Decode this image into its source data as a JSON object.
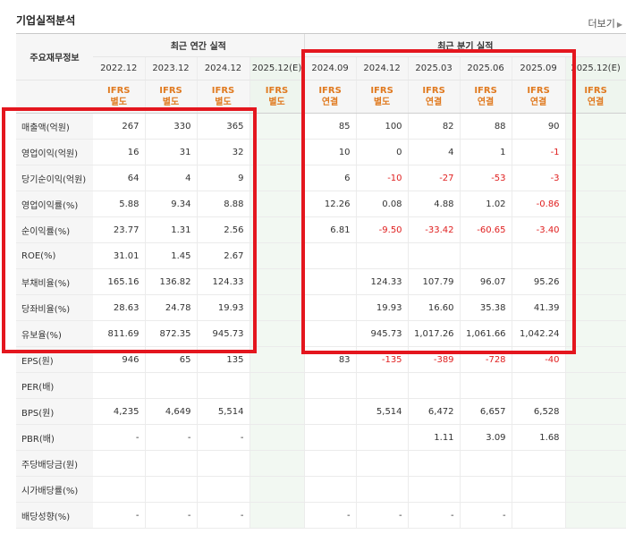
{
  "title": "기업실적분석",
  "more_label": "더보기",
  "header": {
    "row_label": "주요재무정보",
    "annual_group": "최근 연간 실적",
    "quarter_group": "최근 분기 실적",
    "periods": [
      "2022.12",
      "2023.12",
      "2024.12",
      "2025.12(E)",
      "2024.09",
      "2024.12",
      "2025.03",
      "2025.06",
      "2025.09",
      "2025.12(E)"
    ],
    "std_top": [
      "IFRS",
      "IFRS",
      "IFRS",
      "IFRS",
      "IFRS",
      "IFRS",
      "IFRS",
      "IFRS",
      "IFRS",
      "IFRS"
    ],
    "std_bottom": [
      "별도",
      "별도",
      "별도",
      "별도",
      "연결",
      "별도",
      "연결",
      "연결",
      "연결",
      "연결"
    ]
  },
  "rows": [
    {
      "label": "매출액(억원)",
      "values": [
        "267",
        "330",
        "365",
        "",
        "85",
        "100",
        "82",
        "88",
        "90",
        ""
      ]
    },
    {
      "label": "영업이익(억원)",
      "values": [
        "16",
        "31",
        "32",
        "",
        "10",
        "0",
        "4",
        "1",
        "-1",
        ""
      ]
    },
    {
      "label": "당기순이익(억원)",
      "values": [
        "64",
        "4",
        "9",
        "",
        "6",
        "-10",
        "-27",
        "-53",
        "-3",
        ""
      ]
    },
    {
      "label": "영업이익률(%)",
      "values": [
        "5.88",
        "9.34",
        "8.88",
        "",
        "12.26",
        "0.08",
        "4.88",
        "1.02",
        "-0.86",
        ""
      ]
    },
    {
      "label": "순이익률(%)",
      "values": [
        "23.77",
        "1.31",
        "2.56",
        "",
        "6.81",
        "-9.50",
        "-33.42",
        "-60.65",
        "-3.40",
        ""
      ]
    },
    {
      "label": "ROE(%)",
      "values": [
        "31.01",
        "1.45",
        "2.67",
        "",
        "",
        "",
        "",
        "",
        "",
        ""
      ]
    },
    {
      "label": "부채비율(%)",
      "values": [
        "165.16",
        "136.82",
        "124.33",
        "",
        "",
        "124.33",
        "107.79",
        "96.07",
        "95.26",
        ""
      ]
    },
    {
      "label": "당좌비율(%)",
      "values": [
        "28.63",
        "24.78",
        "19.93",
        "",
        "",
        "19.93",
        "16.60",
        "35.38",
        "41.39",
        ""
      ]
    },
    {
      "label": "유보율(%)",
      "values": [
        "811.69",
        "872.35",
        "945.73",
        "",
        "",
        "945.73",
        "1,017.26",
        "1,061.66",
        "1,042.24",
        ""
      ]
    },
    {
      "label": "EPS(원)",
      "values": [
        "946",
        "65",
        "135",
        "",
        "83",
        "-135",
        "-389",
        "-728",
        "-40",
        ""
      ]
    },
    {
      "label": "PER(배)",
      "values": [
        "",
        "",
        "",
        "",
        "",
        "",
        "",
        "",
        "",
        ""
      ]
    },
    {
      "label": "BPS(원)",
      "values": [
        "4,235",
        "4,649",
        "5,514",
        "",
        "",
        "5,514",
        "6,472",
        "6,657",
        "6,528",
        ""
      ]
    },
    {
      "label": "PBR(배)",
      "values": [
        "-",
        "-",
        "-",
        "",
        "",
        "",
        "1.11",
        "3.09",
        "1.68",
        ""
      ]
    },
    {
      "label": "주당배당금(원)",
      "values": [
        "",
        "",
        "",
        "",
        "",
        "",
        "",
        "",
        "",
        ""
      ]
    },
    {
      "label": "시가배당률(%)",
      "values": [
        "",
        "",
        "",
        "",
        "",
        "",
        "",
        "",
        "",
        ""
      ]
    },
    {
      "label": "배당성향(%)",
      "values": [
        "-",
        "-",
        "-",
        "",
        "-",
        "-",
        "-",
        "-",
        "",
        ""
      ]
    }
  ],
  "colors": {
    "highlight_box": "#e4161e",
    "negative": "#e02020",
    "ifrs": "#e07a20"
  }
}
